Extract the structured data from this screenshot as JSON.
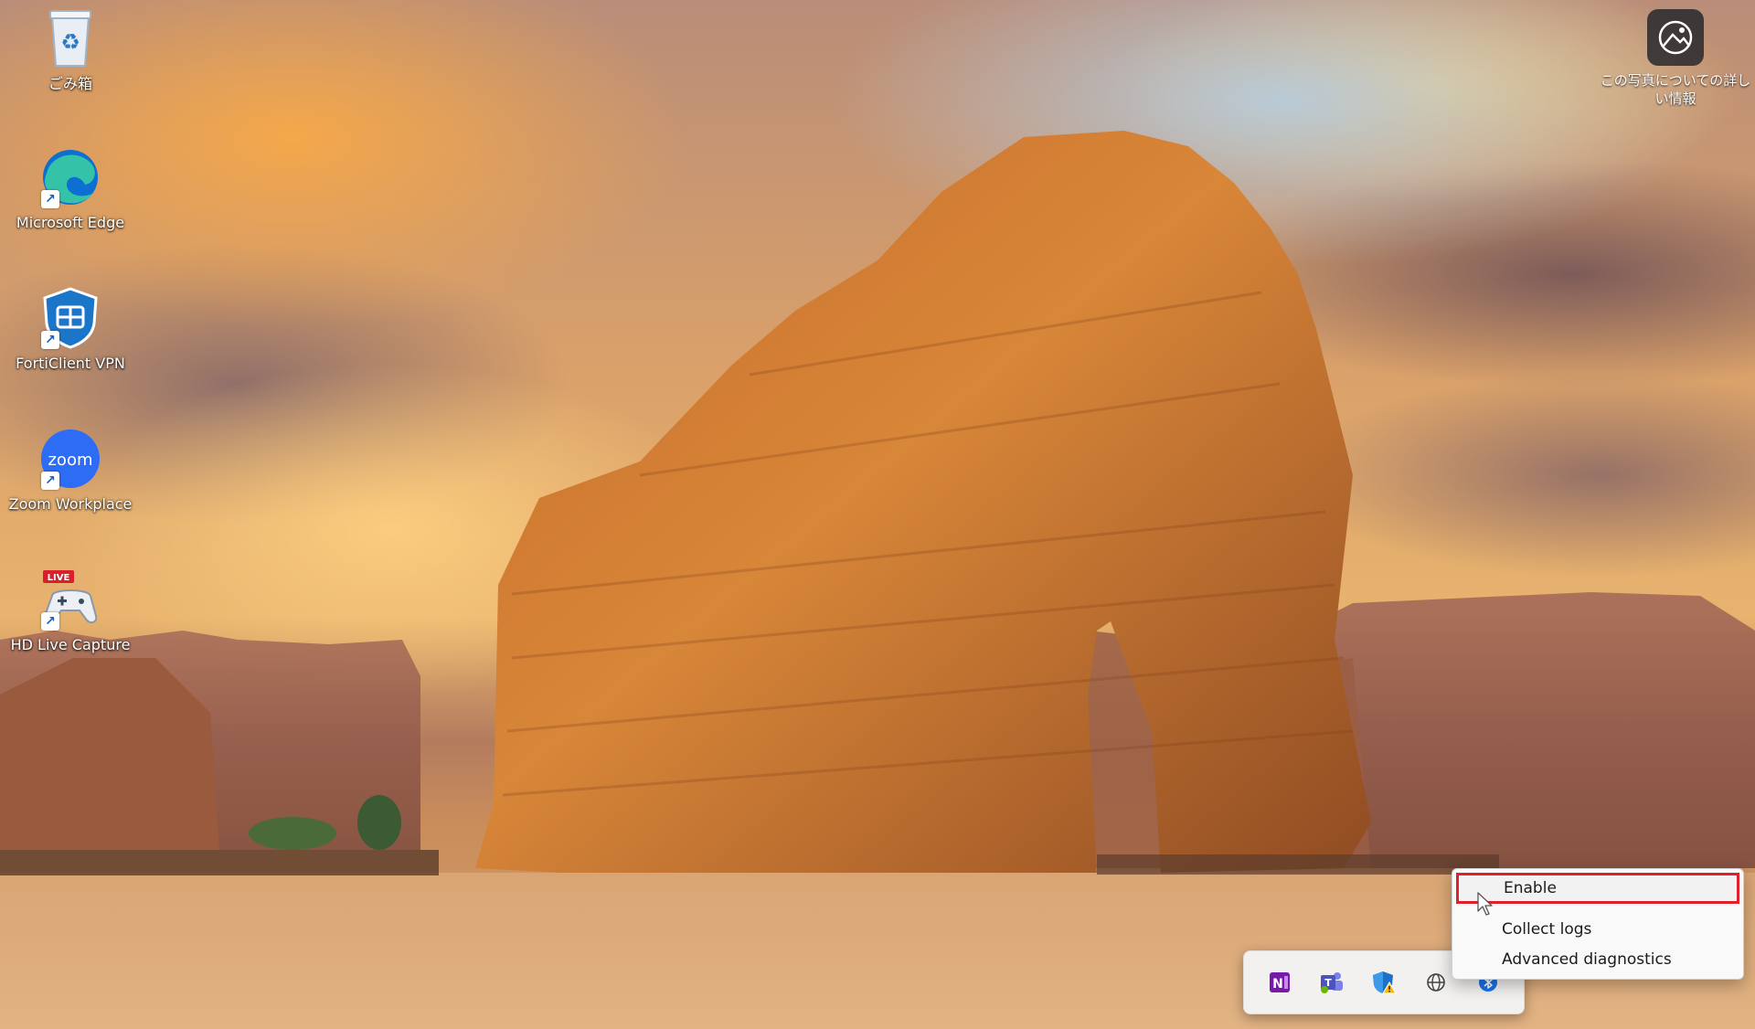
{
  "desktop_icons": [
    {
      "id": "recycle-bin",
      "label": "ごみ箱",
      "icon": "recycle-bin-icon"
    },
    {
      "id": "microsoft-edge",
      "label": "Microsoft Edge",
      "icon": "edge-icon"
    },
    {
      "id": "forticlient-vpn",
      "label": "FortiClient VPN",
      "icon": "forticlient-shield-icon"
    },
    {
      "id": "zoom-workplace",
      "label": "Zoom Workplace",
      "icon": "zoom-icon"
    },
    {
      "id": "hd-live-capture",
      "label": "HD Live Capture",
      "icon": "live-capture-icon",
      "badge": "LIVE"
    }
  ],
  "learn_more": {
    "label": "この写真についての詳しい情報",
    "icon": "camera-info-icon"
  },
  "tray_flyout": {
    "icons": [
      "onenote-icon",
      "teams-icon",
      "defender-warning-icon",
      "network-globe-icon",
      "bluetooth-icon"
    ]
  },
  "context_menu": {
    "items": [
      {
        "label": "Enable",
        "highlighted": true
      },
      {
        "label": "Collect logs"
      },
      {
        "label": "Advanced diagnostics"
      }
    ]
  },
  "colors": {
    "highlight_border": "#e0202a",
    "edge_blue": "#0c6fd1",
    "zoom_blue": "#2d6cf5",
    "onenote_purple": "#7719aa"
  }
}
